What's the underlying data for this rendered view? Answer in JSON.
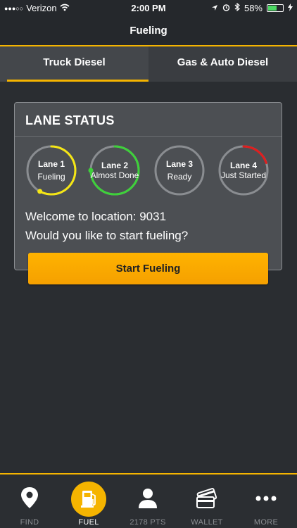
{
  "status_bar": {
    "carrier": "Verizon",
    "time": "2:00 PM",
    "battery": "58%",
    "battery_level": 0.58
  },
  "header": {
    "title": "Fueling"
  },
  "tabs": [
    {
      "label": "Truck Diesel",
      "active": true
    },
    {
      "label": "Gas & Auto Diesel",
      "active": false
    }
  ],
  "lane_status": {
    "title": "LANE STATUS",
    "lanes": [
      {
        "name": "Lane 1",
        "status": "Fueling",
        "progress": 0.58,
        "color": "#f5e614"
      },
      {
        "name": "Lane 2",
        "status": "Almost Done",
        "progress": 0.75,
        "color": "#3ed13a"
      },
      {
        "name": "Lane 3",
        "status": "Ready",
        "progress": 0,
        "color": "#888888"
      },
      {
        "name": "Lane 4",
        "status": "Just Started",
        "progress": 0.2,
        "color": "#e01e1e"
      }
    ],
    "welcome": "Welcome to location: 9031",
    "question": "Would you like to start fueling?"
  },
  "start_button": {
    "label": "Start Fueling"
  },
  "tab_bar": {
    "items": [
      {
        "label": "FIND",
        "icon": "location-pin-icon"
      },
      {
        "label": "FUEL",
        "icon": "fuel-pump-icon",
        "active": true
      },
      {
        "label": "2178 PTS",
        "icon": "person-icon"
      },
      {
        "label": "WALLET",
        "icon": "cards-icon"
      },
      {
        "label": "MORE",
        "icon": "ellipsis-icon"
      }
    ]
  },
  "colors": {
    "accent": "#f5b400",
    "background": "#2a2d31",
    "card": "#4c4f53"
  }
}
